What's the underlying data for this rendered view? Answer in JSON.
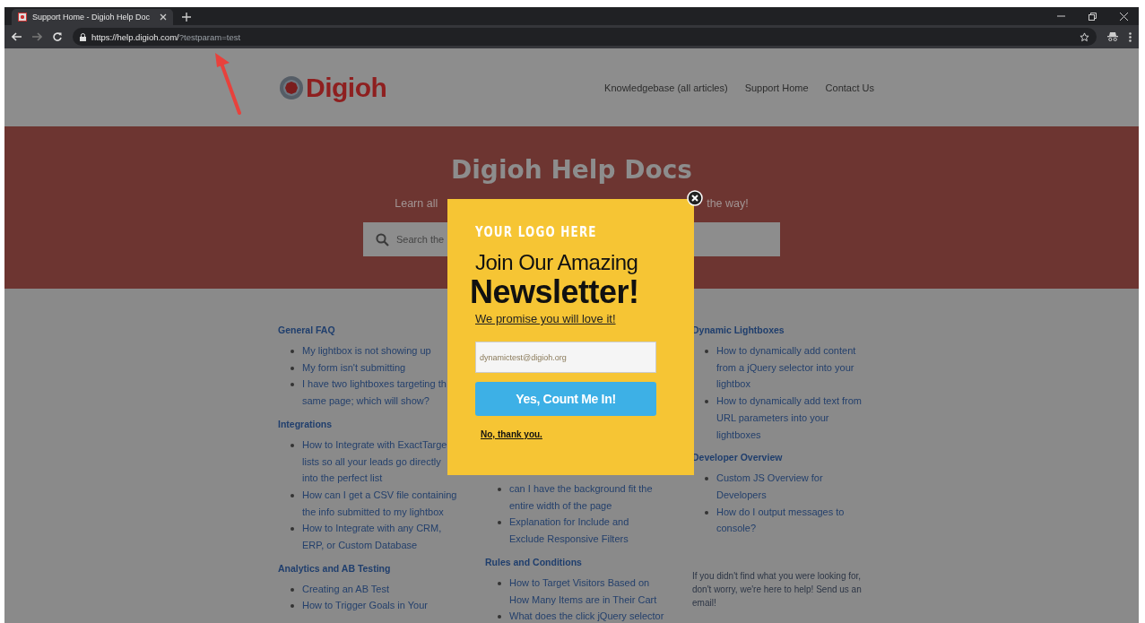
{
  "browser": {
    "tab_title": "Support Home - Digioh Help Doc",
    "url_host": "https://help.digioh.com/",
    "url_query": "?testparam=test"
  },
  "site": {
    "logo": "Digioh",
    "nav": [
      "Knowledgebase (all articles)",
      "Support Home",
      "Contact Us"
    ],
    "hero": {
      "title": "Digioh Help Docs",
      "tagline_left": "Learn all",
      "tagline_right": "the way!",
      "search_placeholder": "Search the"
    },
    "columns": [
      {
        "sections": [
          {
            "heading": "General FAQ",
            "items": [
              "My lightbox is not showing up",
              "My form isn't submitting",
              "I have two lightboxes targeting th same page; which will show?"
            ]
          },
          {
            "heading": "Integrations",
            "items": [
              "How to Integrate with ExactTarge lists so all your leads go directly into the perfect list",
              "How can I get a CSV file containing the info submitted to my lightbox",
              "How to Integrate with any CRM, ERP, or Custom Database"
            ]
          },
          {
            "heading": "Analytics and AB Testing",
            "items": [
              "Creating an AB Test",
              "How to Trigger Goals in Your"
            ]
          }
        ]
      },
      {
        "sections": [
          {
            "items": [
              "can I have the background fit the entire width of the page",
              "Explanation for Include and Exclude Responsive Filters"
            ]
          },
          {
            "heading": "Rules and Conditions",
            "items": [
              "How to Target Visitors Based on How Many Items are in Their Cart",
              "What does the click jQuery selector"
            ]
          }
        ]
      },
      {
        "sections": [
          {
            "heading": "Dynamic Lightboxes",
            "items": [
              "How to dynamically add content from a jQuery selector into your lightbox",
              "How to dynamically add text from URL parameters into your lightboxes"
            ]
          },
          {
            "heading": "Developer Overview",
            "items": [
              "Custom JS Overview for Developers",
              "How do I output messages to console?"
            ]
          }
        ],
        "note": "If you didn't find what you were looking for, don't worry, we're here to help! Send us an email!"
      }
    ]
  },
  "popup": {
    "logo_text": "YOUR LOGO HERE",
    "title_line1": "Join Our Amazing",
    "title_line2": "Newsletter!",
    "promise_link": "We promise you will love it!",
    "email_value": "dynamictest@digioh.org",
    "submit": "Yes, Count Me In!",
    "decline": "No, thank you."
  }
}
